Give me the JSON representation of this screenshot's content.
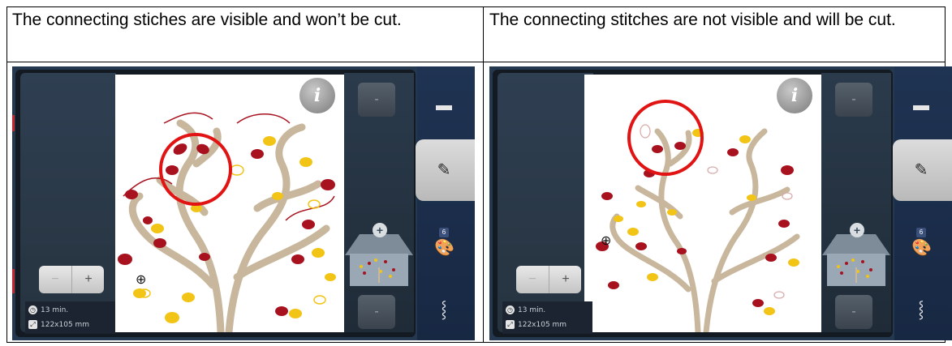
{
  "table": {
    "left_caption": "The connecting stiches are visible and won’t be cut.",
    "right_caption": "The connecting stitches are not visible and will be cut."
  },
  "machine_ui": {
    "info_label": "i",
    "stitch_time": "13 min.",
    "design_size": "122x105 mm",
    "color_count": "6",
    "nav_up_label": "-",
    "nav_down_label": "-",
    "preview_plus": "+",
    "zoom_out_symbol": "−",
    "zoom_in_symbol": "+"
  },
  "icons": {
    "folder": "folder-icon",
    "edit": "pencil-icon",
    "palette": "palette-icon",
    "needle": "needle-icon",
    "clock": "clock-icon",
    "resize": "resize-icon",
    "zoom_out": "zoom-out-icon",
    "zoom_in": "zoom-in-icon",
    "crosshair": "crosshair-icon"
  },
  "colors": {
    "highlight_circle": "#e11313",
    "leaf_red": "#a8121f",
    "leaf_yellow": "#f2c416",
    "branch": "#c8b79c",
    "panel_dark": "#24394f"
  }
}
